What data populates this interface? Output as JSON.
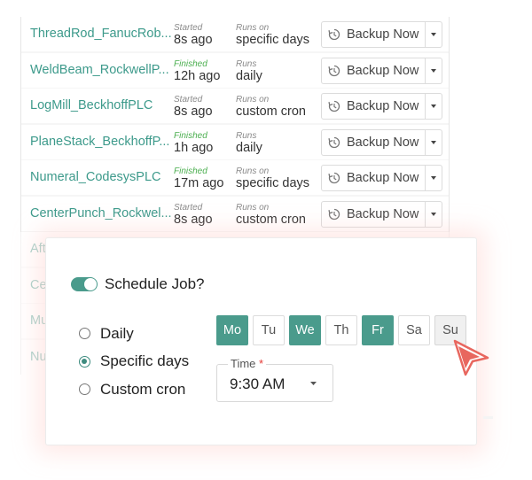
{
  "jobs": [
    {
      "name": "ThreadRod_FanucRob...",
      "status_label": "Started",
      "status_time": "8s ago",
      "runs_label": "Runs on",
      "runs_value": "specific days",
      "backup_label": "Backup Now"
    },
    {
      "name": "WeldBeam_RockwellP...",
      "status_label": "Finished",
      "status_time": "12h ago",
      "runs_label": "Runs",
      "runs_value": "daily",
      "backup_label": "Backup Now"
    },
    {
      "name": "LogMill_BeckhoffPLC",
      "status_label": "Started",
      "status_time": "8s ago",
      "runs_label": "Runs on",
      "runs_value": "custom cron",
      "backup_label": "Backup Now"
    },
    {
      "name": "PlaneStack_BeckhoffP...",
      "status_label": "Finished",
      "status_time": "1h ago",
      "runs_label": "Runs",
      "runs_value": "daily",
      "backup_label": "Backup Now"
    },
    {
      "name": "Numeral_CodesysPLC",
      "status_label": "Finished",
      "status_time": "17m ago",
      "runs_label": "Runs on",
      "runs_value": "specific days",
      "backup_label": "Backup Now"
    },
    {
      "name": "CenterPunch_Rockwel...",
      "status_label": "Started",
      "status_time": "8s ago",
      "runs_label": "Runs on",
      "runs_value": "custom cron",
      "backup_label": "Backup Now"
    },
    {
      "name": "Aft",
      "status_label": "",
      "status_time": "",
      "runs_label": "",
      "runs_value": "",
      "backup_label": ""
    },
    {
      "name": "Ce",
      "status_label": "",
      "status_time": "",
      "runs_label": "",
      "runs_value": "",
      "backup_label": ""
    },
    {
      "name": "Mu",
      "status_label": "",
      "status_time": "",
      "runs_label": "",
      "runs_value": "",
      "backup_label": ""
    },
    {
      "name": "Nu",
      "status_label": "",
      "status_time": "",
      "runs_label": "",
      "runs_value": "",
      "backup_label": ""
    }
  ],
  "dialog": {
    "toggle_label": "Schedule Job?",
    "toggle_on": true,
    "options": [
      {
        "label": "Daily",
        "checked": false
      },
      {
        "label": "Specific days",
        "checked": true
      },
      {
        "label": "Custom cron",
        "checked": false
      }
    ],
    "days": [
      {
        "label": "Mo",
        "selected": true
      },
      {
        "label": "Tu",
        "selected": false
      },
      {
        "label": "We",
        "selected": true
      },
      {
        "label": "Th",
        "selected": false
      },
      {
        "label": "Fr",
        "selected": true
      },
      {
        "label": "Sa",
        "selected": false
      },
      {
        "label": "Su",
        "selected": false
      }
    ],
    "time_label": "Time",
    "time_required_mark": "*",
    "time_value": "9:30 AM"
  },
  "colors": {
    "accent": "#4a9b8c",
    "link": "#3d9a8b",
    "finished": "#4caf50",
    "cursor": "#e8675f"
  },
  "icons": {
    "backup": "refresh-icon",
    "dropdown": "caret-down-icon",
    "pointer": "cursor-arrow-icon"
  }
}
